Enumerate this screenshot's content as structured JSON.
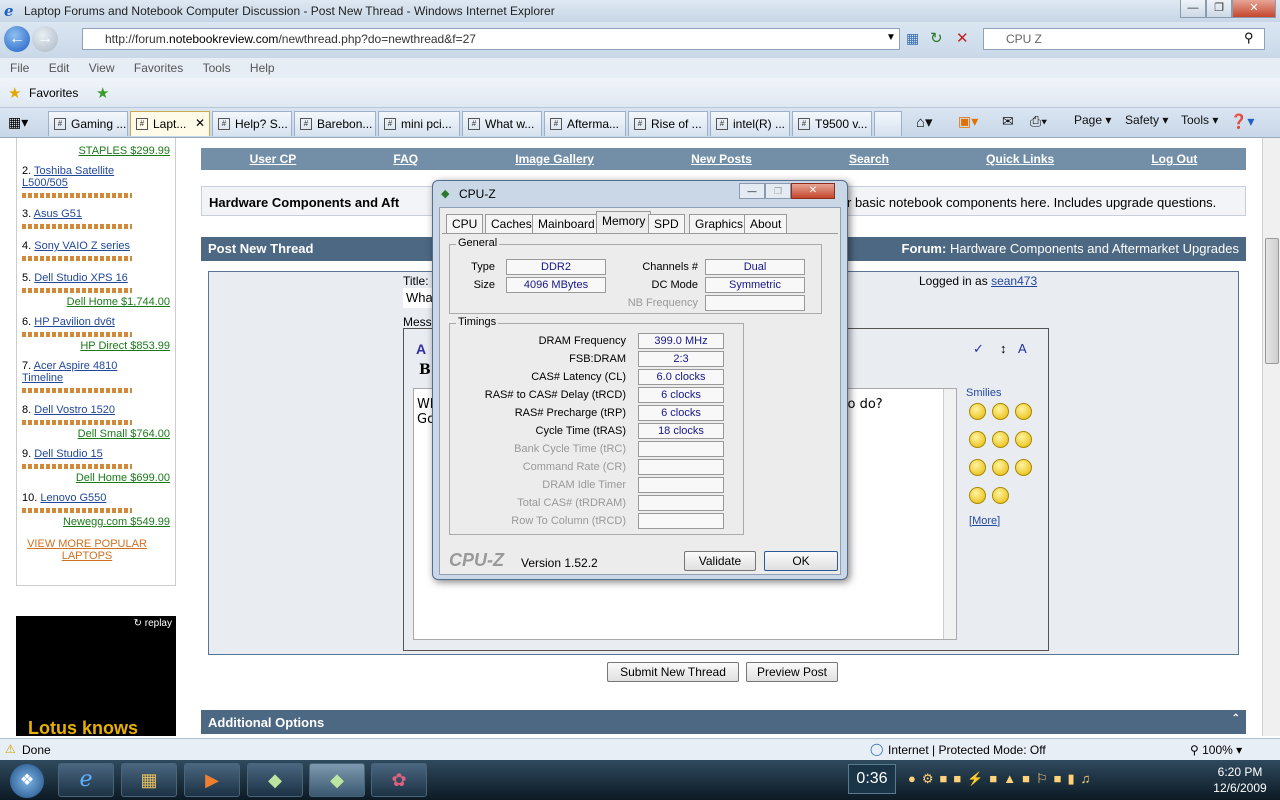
{
  "window": {
    "title": "Laptop Forums and Notebook Computer Discussion - Post New Thread - Windows Internet Explorer"
  },
  "address": {
    "url_prefix": "http://forum.",
    "url_host": "notebookreview.com",
    "url_suffix": "/newthread.php?do=newthread&f=27",
    "search_placeholder": "CPU Z"
  },
  "menu": [
    "File",
    "Edit",
    "View",
    "Favorites",
    "Tools",
    "Help"
  ],
  "favorites": {
    "label": "Favorites"
  },
  "tabs": [
    "Gaming ...",
    "Lapt...",
    "Help? S...",
    "Barebon...",
    "mini pci...",
    "What w...",
    "Afterma...",
    "Rise of ...",
    "intel(R) ...",
    "T9500 v..."
  ],
  "commands": {
    "page": "Page",
    "safety": "Safety",
    "tools": "Tools"
  },
  "sidebar": {
    "top_price": "STAPLES $299.99",
    "items": [
      {
        "num": "2.",
        "name": "Toshiba Satellite",
        "name2": "L500/505",
        "price": ""
      },
      {
        "num": "3.",
        "name": "Asus G51",
        "price": ""
      },
      {
        "num": "4.",
        "name": "Sony VAIO Z series",
        "price": ""
      },
      {
        "num": "5.",
        "name": "Dell Studio XPS 16",
        "price": "Dell Home $1,744.00"
      },
      {
        "num": "6.",
        "name": "HP Pavilion dv6t",
        "price": "HP Direct $853.99"
      },
      {
        "num": "7.",
        "name": "Acer Aspire 4810",
        "name2": "Timeline",
        "price": ""
      },
      {
        "num": "8.",
        "name": "Dell Vostro 1520",
        "price": "Dell Small $764.00"
      },
      {
        "num": "9.",
        "name": "Dell Studio 15",
        "price": "Dell Home $699.00"
      },
      {
        "num": "10.",
        "name": "Lenovo G550",
        "price": "Newegg.com $549.99"
      }
    ],
    "view_more": "VIEW MORE POPULAR",
    "view_more2": "LAPTOPS",
    "ad_replay": "replay",
    "ad_text": "Lotus knows"
  },
  "forum_nav": [
    "User CP",
    "FAQ",
    "Image Gallery",
    "New Posts",
    "Search",
    "Quick Links",
    "Log Out"
  ],
  "forum_desc": {
    "title": "Hardware Components and Aft",
    "rest": "r basic notebook components here. Includes upgrade questions."
  },
  "post": {
    "header": "Post New Thread",
    "forum_label": "Forum:",
    "forum_name": "Hardware Components and Aftermarket Upgrades",
    "title_label": "Title:",
    "title_value": "Wha",
    "message_label": "Mess",
    "logged_in_label": "Logged in as",
    "user": "sean473",
    "message_line1": "Wh",
    "message_line1_end": "d to do?",
    "message_line2": "Go",
    "smilies_label": "Smilies",
    "smilies_more": "More",
    "submit": "Submit New Thread",
    "preview": "Preview Post",
    "additional": "Additional Options"
  },
  "cpuz": {
    "title": "CPU-Z",
    "tabs": [
      "CPU",
      "Caches",
      "Mainboard",
      "Memory",
      "SPD",
      "Graphics",
      "About"
    ],
    "general_label": "General",
    "type_label": "Type",
    "type_value": "DDR2",
    "size_label": "Size",
    "size_value": "4096 MBytes",
    "channels_label": "Channels #",
    "channels_value": "Dual",
    "dcmode_label": "DC Mode",
    "dcmode_value": "Symmetric",
    "nbfreq_label": "NB Frequency",
    "nbfreq_value": "",
    "timings_label": "Timings",
    "timings": [
      {
        "label": "DRAM Frequency",
        "value": "399.0 MHz",
        "dim": false
      },
      {
        "label": "FSB:DRAM",
        "value": "2:3",
        "dim": false
      },
      {
        "label": "CAS# Latency (CL)",
        "value": "6.0 clocks",
        "dim": false
      },
      {
        "label": "RAS# to CAS# Delay (tRCD)",
        "value": "6 clocks",
        "dim": false
      },
      {
        "label": "RAS# Precharge (tRP)",
        "value": "6 clocks",
        "dim": false
      },
      {
        "label": "Cycle Time (tRAS)",
        "value": "18 clocks",
        "dim": false
      },
      {
        "label": "Bank Cycle Time (tRC)",
        "value": "",
        "dim": true
      },
      {
        "label": "Command Rate (CR)",
        "value": "",
        "dim": true
      },
      {
        "label": "DRAM Idle Timer",
        "value": "",
        "dim": true
      },
      {
        "label": "Total CAS# (tRDRAM)",
        "value": "",
        "dim": true
      },
      {
        "label": "Row To Column (tRCD)",
        "value": "",
        "dim": true
      }
    ],
    "brand": "CPU-Z",
    "version": "Version 1.52.2",
    "validate": "Validate",
    "ok": "OK"
  },
  "status": {
    "text": "Done",
    "zone": "Internet | Protected Mode: Off",
    "zoom": "100%"
  },
  "taskbar": {
    "timer": "0:36",
    "time": "6:20 PM",
    "date": "12/6/2009"
  }
}
